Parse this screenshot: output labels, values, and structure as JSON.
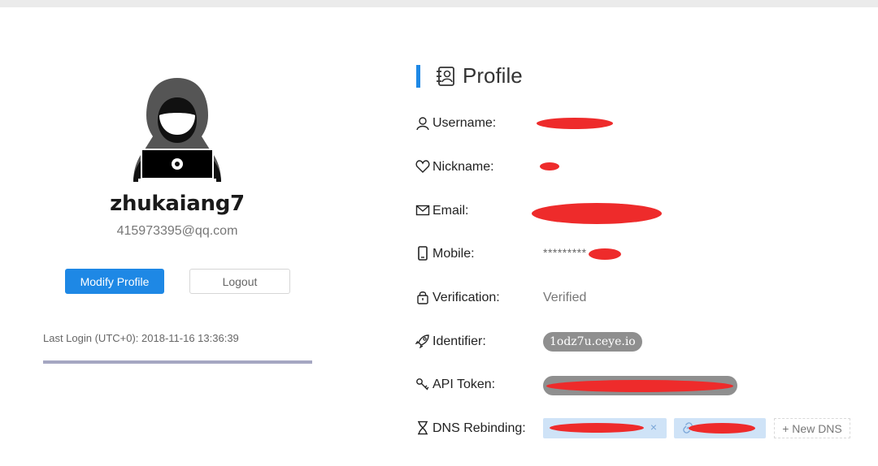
{
  "user": {
    "username": "zhukaiang7",
    "email": "415973395@qq.com",
    "last_login": "Last Login (UTC+0): 2018-11-16 13:36:39"
  },
  "buttons": {
    "modify_profile": "Modify Profile",
    "logout": "Logout"
  },
  "profile": {
    "title": "Profile",
    "rows": {
      "username": {
        "label": "Username:"
      },
      "nickname": {
        "label": "Nickname:"
      },
      "email": {
        "label": "Email:"
      },
      "mobile": {
        "label": "Mobile:",
        "value": "*********"
      },
      "verification": {
        "label": "Verification:",
        "value": "Verified"
      },
      "identifier": {
        "label": "Identifier:",
        "value": "1odz7u.ceye.io"
      },
      "api_token": {
        "label": "API Token:"
      },
      "dns_rebinding": {
        "label": "DNS Rebinding:",
        "new_dns": "+ New DNS",
        "close_glyph": "×"
      }
    }
  },
  "icons": [
    "avatar-hacker-icon",
    "profile-card-icon",
    "user-icon",
    "heart-icon",
    "mail-icon",
    "mobile-icon",
    "lock-icon",
    "rocket-icon",
    "key-icon",
    "hourglass-icon",
    "link-icon",
    "close-icon"
  ],
  "colors": {
    "accent": "#1e88e5",
    "redaction": "#ee2b2b",
    "tag_bg": "#cfe3f7",
    "pill_bg": "#8f8f8f"
  }
}
